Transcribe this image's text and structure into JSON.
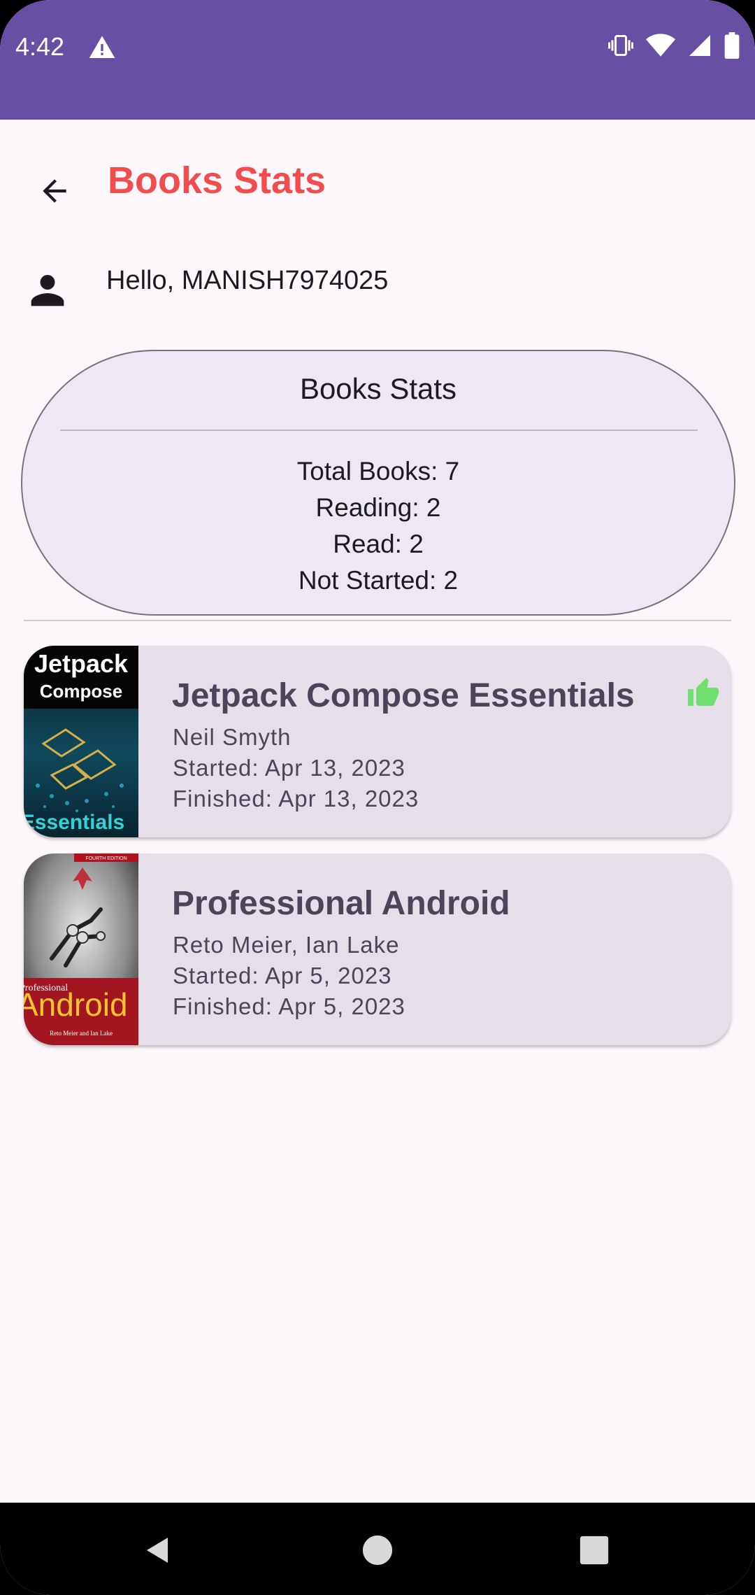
{
  "status_bar": {
    "time": "4:42",
    "icons": [
      "warning-icon",
      "vibrate-icon",
      "wifi-icon",
      "signal-icon",
      "battery-icon"
    ]
  },
  "app_bar": {
    "title": "Books Stats",
    "back_icon": "arrow-back-icon",
    "title_color": "#f14d4d"
  },
  "greeting": {
    "text": "Hello, MANISH7974025",
    "icon": "person-icon"
  },
  "stats": {
    "title": "Books Stats",
    "total": "Total Books: 7",
    "reading": "Reading: 2",
    "read": "Read: 2",
    "not_started": "Not Started: 2"
  },
  "books": [
    {
      "title": "Jetpack Compose Essentials",
      "author": "Neil Smyth",
      "started": "Started: Apr 13, 2023",
      "finished": "Finished: Apr 13, 2023",
      "liked": true,
      "cover_text": [
        "Jetpack",
        "Compose",
        "Essentials"
      ]
    },
    {
      "title": "Professional Android",
      "author": "Reto Meier, Ian Lake",
      "started": "Started: Apr 5, 2023",
      "finished": "Finished: Apr 5, 2023",
      "liked": false,
      "cover_text": [
        "FOURTH EDITION",
        "Professional",
        "Android",
        "Reto Meier and Ian Lake"
      ]
    }
  ],
  "nav_bar": {
    "buttons": [
      "back-triangle-icon",
      "home-circle-icon",
      "recents-square-icon"
    ]
  },
  "colors": {
    "status_bar": "#6750a4",
    "background": "#fdf7fb",
    "card": "#e6dfea",
    "stats_card": "#ede8f4",
    "liked_icon": "#6fe06f"
  }
}
